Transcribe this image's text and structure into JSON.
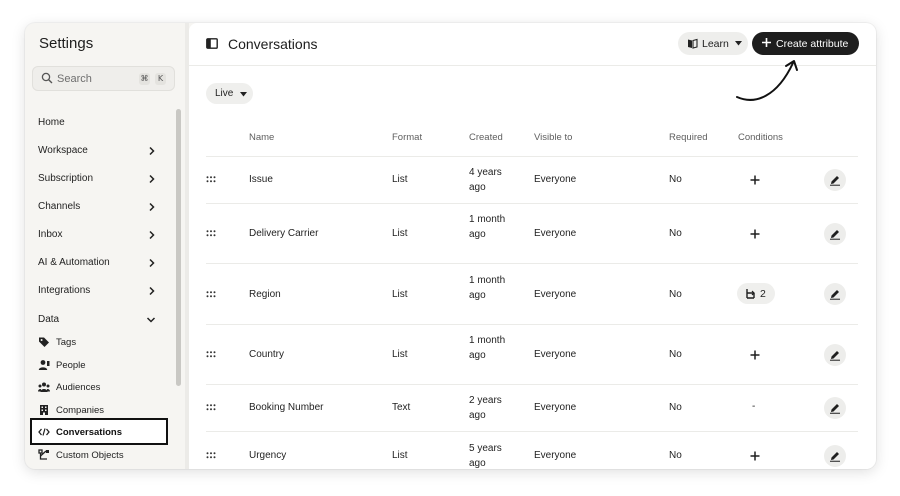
{
  "sidebar": {
    "title": "Settings",
    "search": {
      "placeholder": "Search",
      "shortcut_keys": [
        "⌘",
        "K"
      ]
    },
    "nav_items": [
      {
        "label": "Home",
        "chevron": "none"
      },
      {
        "label": "Workspace",
        "chevron": "chevron-right"
      },
      {
        "label": "Subscription",
        "chevron": "chevron-right"
      },
      {
        "label": "Channels",
        "chevron": "chevron-right"
      },
      {
        "label": "Inbox",
        "chevron": "chevron-right"
      },
      {
        "label": "AI & Automation",
        "chevron": "chevron-right"
      },
      {
        "label": "Integrations",
        "chevron": "chevron-right"
      },
      {
        "label": "Data",
        "chevron": "chevron-down"
      }
    ],
    "data_sub_items": [
      {
        "label": "Tags",
        "icon": "tag-icon"
      },
      {
        "label": "People",
        "icon": "people-icon"
      },
      {
        "label": "Audiences",
        "icon": "audiences-icon"
      },
      {
        "label": "Companies",
        "icon": "companies-icon"
      },
      {
        "label": "Conversations",
        "icon": "code-brackets-icon",
        "active": true
      },
      {
        "label": "Custom Objects",
        "icon": "custom-objects-icon"
      }
    ]
  },
  "header": {
    "title": "Conversations",
    "learn_label": "Learn",
    "create_label": "Create attribute"
  },
  "filter": {
    "label": "Live"
  },
  "table": {
    "columns": [
      "Name",
      "Format",
      "Created",
      "Visible to",
      "Required",
      "Conditions"
    ],
    "rows": [
      {
        "name": "Issue",
        "format": "List",
        "created": "4 years ago",
        "visible_to": "Everyone",
        "required": "No",
        "conditions": "+",
        "conditions_count": null
      },
      {
        "name": "Delivery Carrier",
        "format": "List",
        "created": "1 month ago",
        "visible_to": "Everyone",
        "required": "No",
        "conditions": "+",
        "conditions_count": null
      },
      {
        "name": "Region",
        "format": "List",
        "created": "1 month ago",
        "visible_to": "Everyone",
        "required": "No",
        "conditions": "badge",
        "conditions_count": "2"
      },
      {
        "name": "Country",
        "format": "List",
        "created": "1 month ago",
        "visible_to": "Everyone",
        "required": "No",
        "conditions": "+",
        "conditions_count": null
      },
      {
        "name": "Booking Number",
        "format": "Text",
        "created": "2 years ago",
        "visible_to": "Everyone",
        "required": "No",
        "conditions": "-",
        "conditions_count": null
      },
      {
        "name": "Urgency",
        "format": "List",
        "created": "5 years ago",
        "visible_to": "Everyone",
        "required": "No",
        "conditions": "+",
        "conditions_count": null
      }
    ]
  },
  "colors": {
    "sidebar_bg": "#f6f5f2",
    "primary_button": "#1e1e1e",
    "pill_bg": "#efefed"
  }
}
